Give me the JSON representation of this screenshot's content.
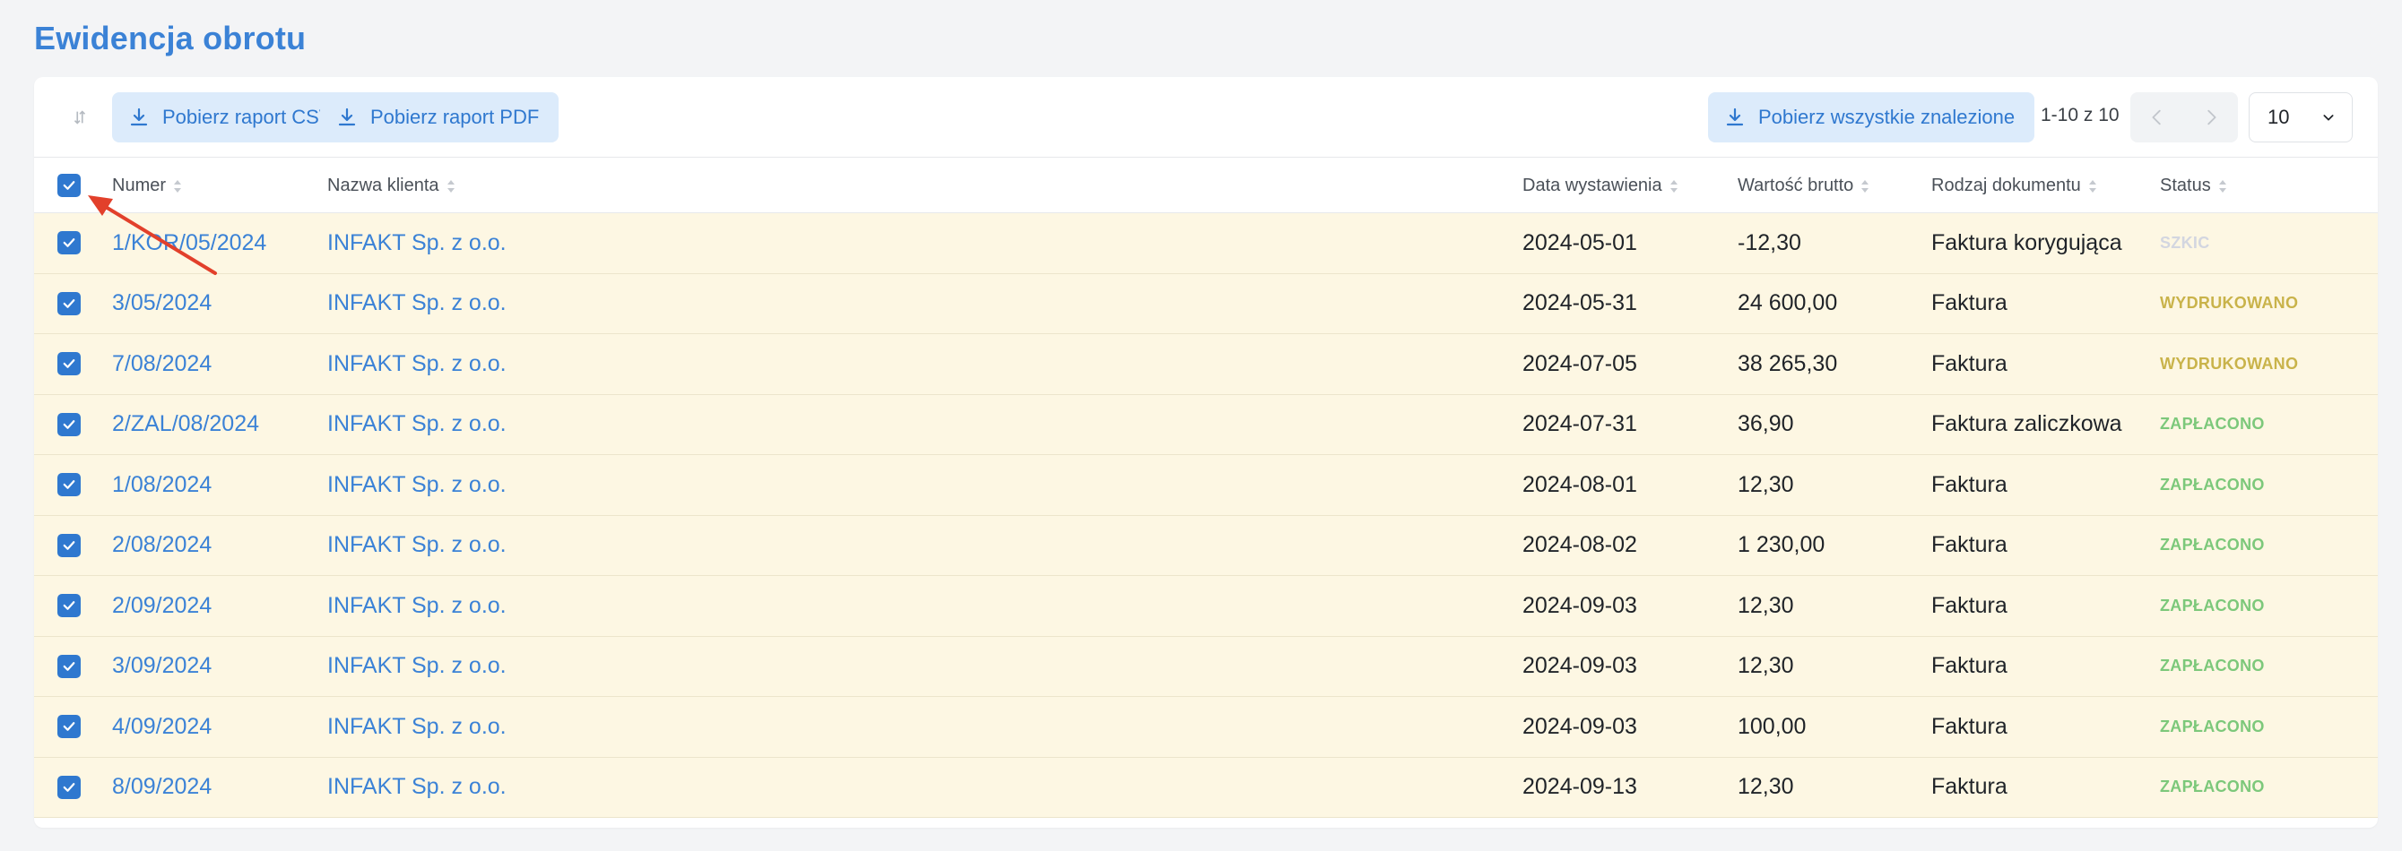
{
  "page": {
    "title": "Ewidencja obrotu"
  },
  "toolbar": {
    "csv_label": "Pobierz raport CSV",
    "pdf_label": "Pobierz raport PDF",
    "all_label": "Pobierz wszystkie znalezione",
    "pager_text": "1-10 z 10",
    "per_page_value": "10"
  },
  "columns": {
    "number": "Numer",
    "client": "Nazwa klienta",
    "date": "Data wystawienia",
    "value": "Wartość brutto",
    "type": "Rodzaj dokumentu",
    "status": "Status"
  },
  "status_colors": {
    "SZKIC": "#d3d6e0",
    "WYDRUKOWANO": "#c9b34a",
    "ZAPŁACONO": "#7cc87a"
  },
  "rows": [
    {
      "number": "1/KOR/05/2024",
      "client": "INFAKT Sp. z o.o.",
      "date": "2024-05-01",
      "value": "-12,30",
      "type": "Faktura korygująca",
      "status": "SZKIC"
    },
    {
      "number": "3/05/2024",
      "client": "INFAKT Sp. z o.o.",
      "date": "2024-05-31",
      "value": "24 600,00",
      "type": "Faktura",
      "status": "WYDRUKOWANO"
    },
    {
      "number": "7/08/2024",
      "client": "INFAKT Sp. z o.o.",
      "date": "2024-07-05",
      "value": "38 265,30",
      "type": "Faktura",
      "status": "WYDRUKOWANO"
    },
    {
      "number": "2/ZAL/08/2024",
      "client": "INFAKT Sp. z o.o.",
      "date": "2024-07-31",
      "value": "36,90",
      "type": "Faktura zaliczkowa",
      "status": "ZAPŁACONO"
    },
    {
      "number": "1/08/2024",
      "client": "INFAKT Sp. z o.o.",
      "date": "2024-08-01",
      "value": "12,30",
      "type": "Faktura",
      "status": "ZAPŁACONO"
    },
    {
      "number": "2/08/2024",
      "client": "INFAKT Sp. z o.o.",
      "date": "2024-08-02",
      "value": "1 230,00",
      "type": "Faktura",
      "status": "ZAPŁACONO"
    },
    {
      "number": "2/09/2024",
      "client": "INFAKT Sp. z o.o.",
      "date": "2024-09-03",
      "value": "12,30",
      "type": "Faktura",
      "status": "ZAPŁACONO"
    },
    {
      "number": "3/09/2024",
      "client": "INFAKT Sp. z o.o.",
      "date": "2024-09-03",
      "value": "12,30",
      "type": "Faktura",
      "status": "ZAPŁACONO"
    },
    {
      "number": "4/09/2024",
      "client": "INFAKT Sp. z o.o.",
      "date": "2024-09-03",
      "value": "100,00",
      "type": "Faktura",
      "status": "ZAPŁACONO"
    },
    {
      "number": "8/09/2024",
      "client": "INFAKT Sp. z o.o.",
      "date": "2024-09-13",
      "value": "12,30",
      "type": "Faktura",
      "status": "ZAPŁACONO"
    }
  ],
  "icons": {
    "sort_toggle": "sort-toggle-icon",
    "download": "download-icon",
    "prev": "chevron-left-icon",
    "next": "chevron-right-icon",
    "dropdown": "chevron-down-icon",
    "checkbox": "checkmark-icon",
    "annotation": "red-arrow-annotation"
  },
  "colors": {
    "accent": "#2f78cf",
    "title": "#3b82d6",
    "row_highlight": "#fdf7e3",
    "annotation_arrow": "#e2402b"
  }
}
